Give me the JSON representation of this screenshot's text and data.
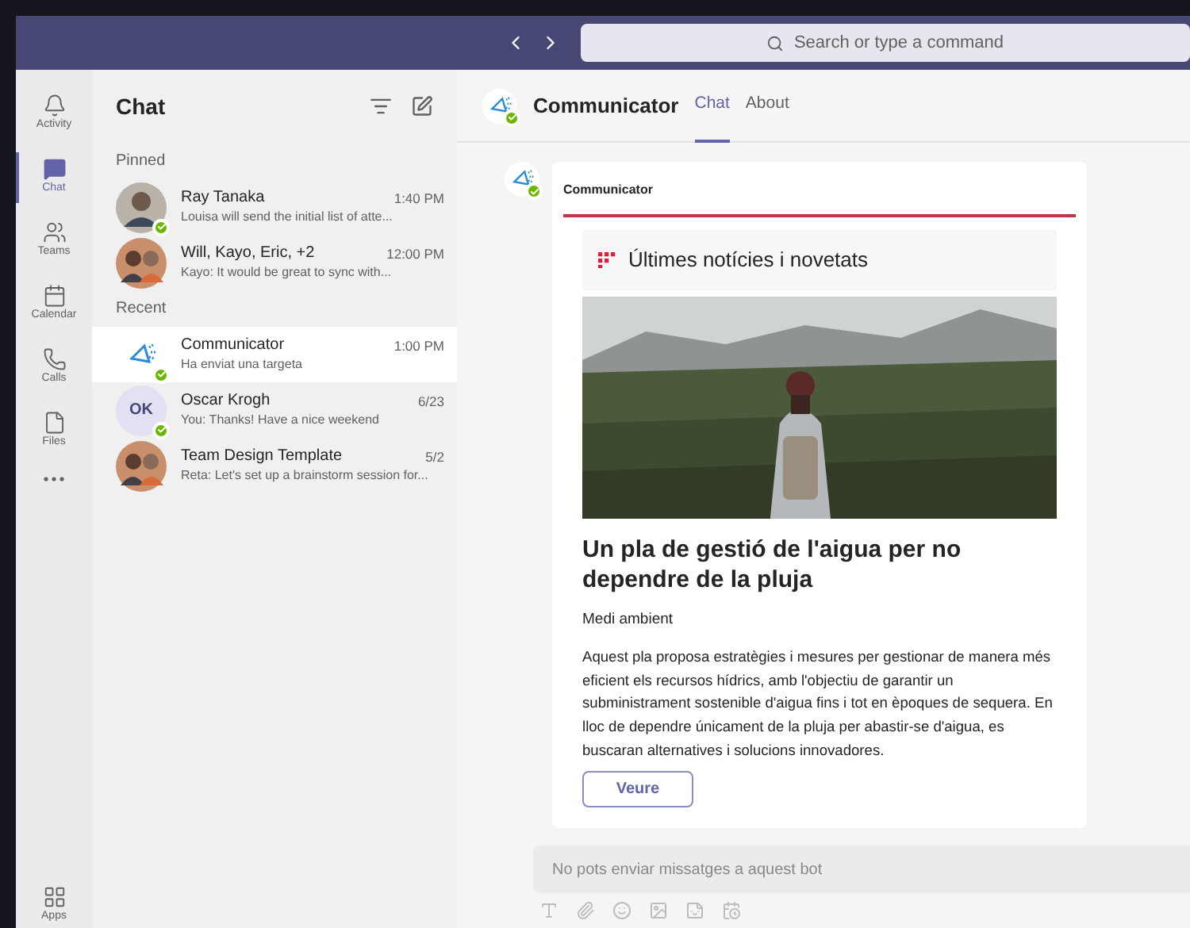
{
  "top_bar": {
    "search": {
      "placeholder": "Search or type a command"
    }
  },
  "rail": {
    "items": [
      {
        "label": "Activity",
        "kind": "bell",
        "selected": false
      },
      {
        "label": "Chat",
        "kind": "chat",
        "selected": true
      },
      {
        "label": "Teams",
        "kind": "teams",
        "selected": false
      },
      {
        "label": "Calendar",
        "kind": "calendar",
        "selected": false
      },
      {
        "label": "Calls",
        "kind": "calls",
        "selected": false
      },
      {
        "label": "Files",
        "kind": "files",
        "selected": false
      }
    ],
    "apps": {
      "label": "Apps"
    }
  },
  "chat_list": {
    "title": "Chat",
    "sections": [
      {
        "title": "Pinned",
        "items": [
          {
            "name": "Ray Tanaka",
            "time": "1:40 PM",
            "preview": "Louisa will send the initial list of atte...",
            "online": true,
            "selected": false
          },
          {
            "name": "Will, Kayo, Eric, +2",
            "time": "12:00 PM",
            "preview": "Kayo: It would be great to sync with...",
            "avatar": {
              "kind": "group"
            },
            "online": false,
            "selected": false
          }
        ]
      },
      {
        "title": "Recent",
        "items": [
          {
            "name": "Communicator",
            "time": "1:00 PM",
            "preview": "Ha enviat una targeta",
            "avatar": {
              "kind": "bot"
            },
            "online": true,
            "selected": true
          },
          {
            "name": "Oscar Krogh",
            "time": "6/23",
            "preview": "You: Thanks! Have a nice weekend",
            "avatar": {
              "kind": "initials",
              "initials": "OK"
            },
            "online": true,
            "selected": false
          },
          {
            "name": "Team Design Template",
            "time": "5/2",
            "preview": "Reta: Let's set up a brainstorm session for...",
            "avatar": {
              "kind": "group"
            },
            "online": false,
            "selected": false
          }
        ]
      }
    ]
  },
  "conversation": {
    "name": "Communicator",
    "online": true,
    "tabs": [
      {
        "label": "Chat",
        "selected": true
      },
      {
        "label": "About",
        "selected": false
      }
    ],
    "message": {
      "sender": "Communicator",
      "online": true,
      "card": {
        "header": "Últimes notícies i novetats",
        "title": "Un pla de gestió de l'aigua per no dependre de la pluja",
        "category": "Medi ambient",
        "body": "Aquest pla proposa estratègies i mesures per gestionar de manera més eficient els recursos hídrics, amb l'objectiu de garantir un subministrament sostenible d'aigua fins i tot en èpoques de sequera. En lloc de dependre únicament de la pluja per abastir-se d'aigua, es buscaran alternatives i solucions innovadores.",
        "button": "Veure"
      }
    },
    "compose": {
      "placeholder": "No pots enviar missatges a aquest bot"
    }
  }
}
